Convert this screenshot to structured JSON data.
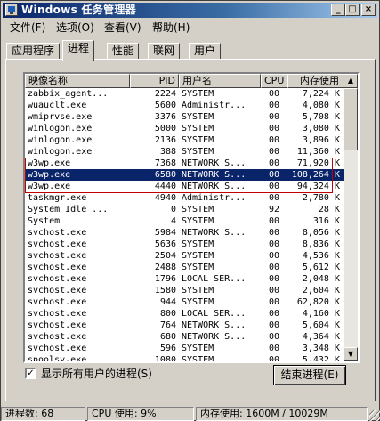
{
  "window": {
    "title": "Windows 任务管理器",
    "controls": {
      "minimize": "_",
      "maximize": "□",
      "close": "×"
    }
  },
  "menu": [
    "文件(F)",
    "选项(O)",
    "查看(V)",
    "帮助(H)"
  ],
  "tabs": [
    "应用程序",
    "进程",
    "性能",
    "联网",
    "用户"
  ],
  "active_tab": "进程",
  "columns": [
    "映像名称",
    "PID",
    "用户名",
    "CPU",
    "内存使用"
  ],
  "rows": [
    {
      "name": "zabbix_agent...",
      "pid": "2224",
      "user": "SYSTEM",
      "cpu": "00",
      "mem": "7,224 K"
    },
    {
      "name": "wuauclt.exe",
      "pid": "5600",
      "user": "Administr...",
      "cpu": "00",
      "mem": "4,080 K"
    },
    {
      "name": "wmiprvse.exe",
      "pid": "3376",
      "user": "SYSTEM",
      "cpu": "00",
      "mem": "5,708 K"
    },
    {
      "name": "winlogon.exe",
      "pid": "5000",
      "user": "SYSTEM",
      "cpu": "00",
      "mem": "3,080 K"
    },
    {
      "name": "winlogon.exe",
      "pid": "2136",
      "user": "SYSTEM",
      "cpu": "00",
      "mem": "3,896 K"
    },
    {
      "name": "winlogon.exe",
      "pid": "388",
      "user": "SYSTEM",
      "cpu": "00",
      "mem": "11,360 K"
    },
    {
      "name": "w3wp.exe",
      "pid": "7368",
      "user": "NETWORK S...",
      "cpu": "00",
      "mem": "71,920 K"
    },
    {
      "name": "w3wp.exe",
      "pid": "6580",
      "user": "NETWORK S...",
      "cpu": "00",
      "mem": "108,264 K",
      "selected": true
    },
    {
      "name": "w3wp.exe",
      "pid": "4440",
      "user": "NETWORK S...",
      "cpu": "00",
      "mem": "94,324 K"
    },
    {
      "name": "taskmgr.exe",
      "pid": "4940",
      "user": "Administr...",
      "cpu": "00",
      "mem": "2,780 K"
    },
    {
      "name": "System Idle ...",
      "pid": "0",
      "user": "SYSTEM",
      "cpu": "92",
      "mem": "28 K"
    },
    {
      "name": "System",
      "pid": "4",
      "user": "SYSTEM",
      "cpu": "00",
      "mem": "316 K"
    },
    {
      "name": "svchost.exe",
      "pid": "5984",
      "user": "NETWORK S...",
      "cpu": "00",
      "mem": "8,056 K"
    },
    {
      "name": "svchost.exe",
      "pid": "5636",
      "user": "SYSTEM",
      "cpu": "00",
      "mem": "8,836 K"
    },
    {
      "name": "svchost.exe",
      "pid": "2504",
      "user": "SYSTEM",
      "cpu": "00",
      "mem": "4,536 K"
    },
    {
      "name": "svchost.exe",
      "pid": "2488",
      "user": "SYSTEM",
      "cpu": "00",
      "mem": "5,612 K"
    },
    {
      "name": "svchost.exe",
      "pid": "1796",
      "user": "LOCAL SER...",
      "cpu": "00",
      "mem": "2,048 K"
    },
    {
      "name": "svchost.exe",
      "pid": "1580",
      "user": "SYSTEM",
      "cpu": "00",
      "mem": "2,604 K"
    },
    {
      "name": "svchost.exe",
      "pid": "944",
      "user": "SYSTEM",
      "cpu": "00",
      "mem": "62,820 K"
    },
    {
      "name": "svchost.exe",
      "pid": "800",
      "user": "LOCAL SER...",
      "cpu": "00",
      "mem": "4,160 K"
    },
    {
      "name": "svchost.exe",
      "pid": "764",
      "user": "NETWORK S...",
      "cpu": "00",
      "mem": "5,604 K"
    },
    {
      "name": "svchost.exe",
      "pid": "680",
      "user": "NETWORK S...",
      "cpu": "00",
      "mem": "4,364 K"
    },
    {
      "name": "svchost.exe",
      "pid": "596",
      "user": "SYSTEM",
      "cpu": "00",
      "mem": "3,348 K"
    },
    {
      "name": "spoolsv.exe",
      "pid": "1080",
      "user": "SYSTEM",
      "cpu": "00",
      "mem": "5,432 K"
    }
  ],
  "show_all_users": {
    "label": "显示所有用户的进程(S)",
    "checked": true,
    "mark": "✓"
  },
  "end_process_label": "结束进程(E)",
  "status": {
    "processes": "进程数: 68",
    "cpu": "CPU 使用: 9%",
    "memory": "内存使用: 1600M / 10029M"
  },
  "colors": {
    "title_bar": "#0a246a",
    "selection": "#0a246a",
    "highlight_box": "#c00000"
  }
}
